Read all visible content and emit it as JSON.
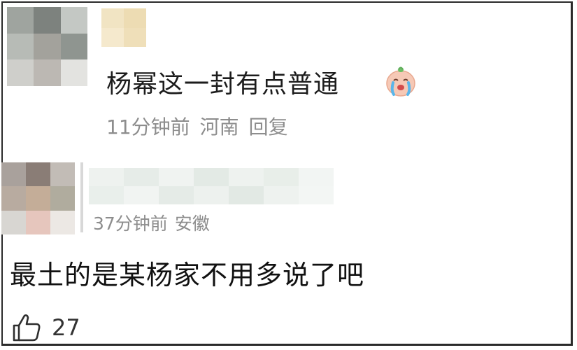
{
  "comment": {
    "avatar_icon": "blurred-avatar",
    "text": "杨幂这一封有点普通",
    "emoji_icon": "crying-face-emoji",
    "time": "11分钟前",
    "location": "河南",
    "reply_label": "回复"
  },
  "reply": {
    "avatar_icon": "blurred-avatar",
    "time": "37分钟前",
    "location": "安徽",
    "text": "最土的是某杨家不用多说了吧",
    "like_icon": "thumbs-up-icon",
    "like_count": "27"
  },
  "colors": {
    "meta": "#8d8d8d",
    "text": "#1c1c1c",
    "border": "#2a2a2a"
  }
}
